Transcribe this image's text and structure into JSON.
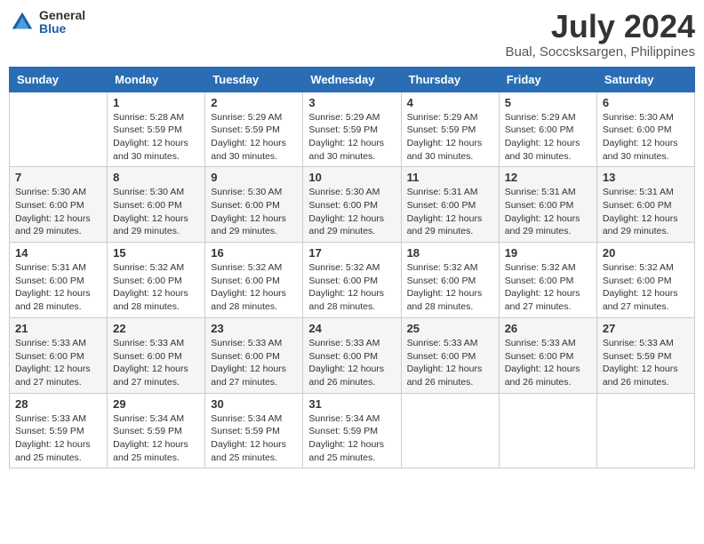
{
  "header": {
    "logo_general": "General",
    "logo_blue": "Blue",
    "month_year": "July 2024",
    "location": "Bual, Soccsksargen, Philippines"
  },
  "weekdays": [
    "Sunday",
    "Monday",
    "Tuesday",
    "Wednesday",
    "Thursday",
    "Friday",
    "Saturday"
  ],
  "weeks": [
    [
      {
        "day": "",
        "info": ""
      },
      {
        "day": "1",
        "info": "Sunrise: 5:28 AM\nSunset: 5:59 PM\nDaylight: 12 hours\nand 30 minutes."
      },
      {
        "day": "2",
        "info": "Sunrise: 5:29 AM\nSunset: 5:59 PM\nDaylight: 12 hours\nand 30 minutes."
      },
      {
        "day": "3",
        "info": "Sunrise: 5:29 AM\nSunset: 5:59 PM\nDaylight: 12 hours\nand 30 minutes."
      },
      {
        "day": "4",
        "info": "Sunrise: 5:29 AM\nSunset: 5:59 PM\nDaylight: 12 hours\nand 30 minutes."
      },
      {
        "day": "5",
        "info": "Sunrise: 5:29 AM\nSunset: 6:00 PM\nDaylight: 12 hours\nand 30 minutes."
      },
      {
        "day": "6",
        "info": "Sunrise: 5:30 AM\nSunset: 6:00 PM\nDaylight: 12 hours\nand 30 minutes."
      }
    ],
    [
      {
        "day": "7",
        "info": "Sunrise: 5:30 AM\nSunset: 6:00 PM\nDaylight: 12 hours\nand 29 minutes."
      },
      {
        "day": "8",
        "info": "Sunrise: 5:30 AM\nSunset: 6:00 PM\nDaylight: 12 hours\nand 29 minutes."
      },
      {
        "day": "9",
        "info": "Sunrise: 5:30 AM\nSunset: 6:00 PM\nDaylight: 12 hours\nand 29 minutes."
      },
      {
        "day": "10",
        "info": "Sunrise: 5:30 AM\nSunset: 6:00 PM\nDaylight: 12 hours\nand 29 minutes."
      },
      {
        "day": "11",
        "info": "Sunrise: 5:31 AM\nSunset: 6:00 PM\nDaylight: 12 hours\nand 29 minutes."
      },
      {
        "day": "12",
        "info": "Sunrise: 5:31 AM\nSunset: 6:00 PM\nDaylight: 12 hours\nand 29 minutes."
      },
      {
        "day": "13",
        "info": "Sunrise: 5:31 AM\nSunset: 6:00 PM\nDaylight: 12 hours\nand 29 minutes."
      }
    ],
    [
      {
        "day": "14",
        "info": "Sunrise: 5:31 AM\nSunset: 6:00 PM\nDaylight: 12 hours\nand 28 minutes."
      },
      {
        "day": "15",
        "info": "Sunrise: 5:32 AM\nSunset: 6:00 PM\nDaylight: 12 hours\nand 28 minutes."
      },
      {
        "day": "16",
        "info": "Sunrise: 5:32 AM\nSunset: 6:00 PM\nDaylight: 12 hours\nand 28 minutes."
      },
      {
        "day": "17",
        "info": "Sunrise: 5:32 AM\nSunset: 6:00 PM\nDaylight: 12 hours\nand 28 minutes."
      },
      {
        "day": "18",
        "info": "Sunrise: 5:32 AM\nSunset: 6:00 PM\nDaylight: 12 hours\nand 28 minutes."
      },
      {
        "day": "19",
        "info": "Sunrise: 5:32 AM\nSunset: 6:00 PM\nDaylight: 12 hours\nand 27 minutes."
      },
      {
        "day": "20",
        "info": "Sunrise: 5:32 AM\nSunset: 6:00 PM\nDaylight: 12 hours\nand 27 minutes."
      }
    ],
    [
      {
        "day": "21",
        "info": "Sunrise: 5:33 AM\nSunset: 6:00 PM\nDaylight: 12 hours\nand 27 minutes."
      },
      {
        "day": "22",
        "info": "Sunrise: 5:33 AM\nSunset: 6:00 PM\nDaylight: 12 hours\nand 27 minutes."
      },
      {
        "day": "23",
        "info": "Sunrise: 5:33 AM\nSunset: 6:00 PM\nDaylight: 12 hours\nand 27 minutes."
      },
      {
        "day": "24",
        "info": "Sunrise: 5:33 AM\nSunset: 6:00 PM\nDaylight: 12 hours\nand 26 minutes."
      },
      {
        "day": "25",
        "info": "Sunrise: 5:33 AM\nSunset: 6:00 PM\nDaylight: 12 hours\nand 26 minutes."
      },
      {
        "day": "26",
        "info": "Sunrise: 5:33 AM\nSunset: 6:00 PM\nDaylight: 12 hours\nand 26 minutes."
      },
      {
        "day": "27",
        "info": "Sunrise: 5:33 AM\nSunset: 5:59 PM\nDaylight: 12 hours\nand 26 minutes."
      }
    ],
    [
      {
        "day": "28",
        "info": "Sunrise: 5:33 AM\nSunset: 5:59 PM\nDaylight: 12 hours\nand 25 minutes."
      },
      {
        "day": "29",
        "info": "Sunrise: 5:34 AM\nSunset: 5:59 PM\nDaylight: 12 hours\nand 25 minutes."
      },
      {
        "day": "30",
        "info": "Sunrise: 5:34 AM\nSunset: 5:59 PM\nDaylight: 12 hours\nand 25 minutes."
      },
      {
        "day": "31",
        "info": "Sunrise: 5:34 AM\nSunset: 5:59 PM\nDaylight: 12 hours\nand 25 minutes."
      },
      {
        "day": "",
        "info": ""
      },
      {
        "day": "",
        "info": ""
      },
      {
        "day": "",
        "info": ""
      }
    ]
  ]
}
